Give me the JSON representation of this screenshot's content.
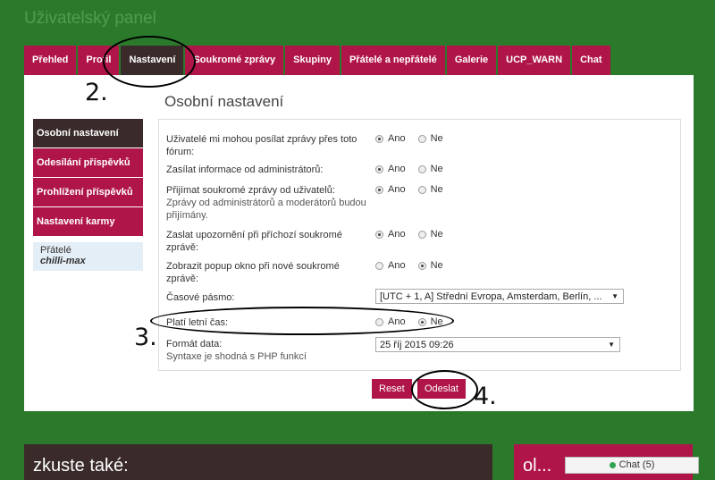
{
  "page": {
    "title": "Uživatelský panel"
  },
  "tabs": [
    "Přehled",
    "Profil",
    "Nastavení",
    "Soukromé zprávy",
    "Skupiny",
    "Přátelé a nepřátelé",
    "Galerie",
    "UCP_WARN",
    "Chat"
  ],
  "section_title": "Osobní nastavení",
  "sidenav": [
    "Osobní nastavení",
    "Odesílání příspěvků",
    "Prohlížení příspěvků",
    "Nastavení karmy"
  ],
  "friends": {
    "label": "Přátelé",
    "name": "chilli-max"
  },
  "settings": [
    {
      "label": "Uživatelé mi mohou posílat zprávy přes toto fórum:",
      "desc": "",
      "yes": "Ano",
      "no": "Ne",
      "selected": "yes"
    },
    {
      "label": "Zasílat informace od administrátorů:",
      "desc": "",
      "yes": "Ano",
      "no": "Ne",
      "selected": "yes"
    },
    {
      "label": "Přijímat soukromé zprávy od uživatelů:",
      "desc": "Zprávy od administrátorů a moderátorů budou přijímány.",
      "yes": "Ano",
      "no": "Ne",
      "selected": "yes"
    },
    {
      "label": "Zaslat upozornění při příchozí soukromé zprávě:",
      "desc": "",
      "yes": "Ano",
      "no": "Ne",
      "selected": "yes"
    },
    {
      "label": "Zobrazit popup okno při nové soukromé zprávě:",
      "desc": "",
      "yes": "Ano",
      "no": "Ne",
      "selected": "no"
    }
  ],
  "timezone": {
    "label": "Časové pásmo:",
    "value": "[UTC + 1, A] Střední Evropa, Amsterdam, Berlín, ..."
  },
  "dst": {
    "label": "Platí letní čas:",
    "yes": "Ano",
    "no": "Ne",
    "selected": "no"
  },
  "date_format": {
    "label": "Formát data:",
    "desc": "Syntaxe je shodná s PHP funkcí",
    "value": "25 říj 2015 09:26"
  },
  "buttons": {
    "reset": "Reset",
    "submit": "Odeslat"
  },
  "annotations": {
    "a2": "2.",
    "a3": "3.",
    "a4": "4."
  },
  "bottom": {
    "left": "zkuste také:",
    "right": "ol..."
  },
  "chat": {
    "label": "Chat (5)"
  }
}
